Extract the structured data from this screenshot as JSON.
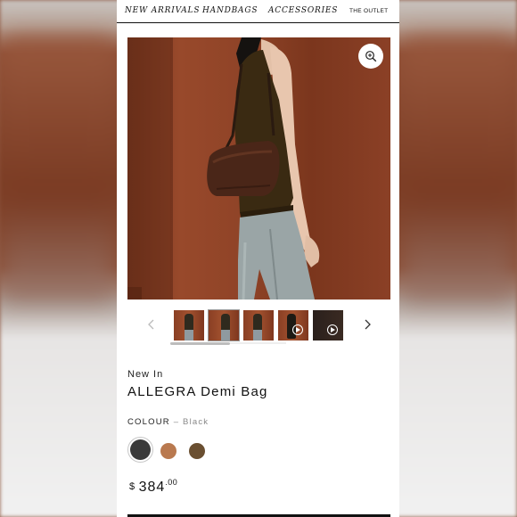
{
  "nav": {
    "items": [
      "NEW ARRIVALS",
      "HANDBAGS",
      "ACCESSORIES"
    ],
    "outlet": "THE OUTLET"
  },
  "gallery": {
    "zoom_icon": "zoom-in-icon",
    "prev_icon": "chevron-left-icon",
    "next_icon": "chevron-right-icon",
    "thumbnail_count": 5,
    "video_thumbnails": [
      4,
      5
    ]
  },
  "product": {
    "badge": "New In",
    "name": "ALLEGRA Demi Bag",
    "colour_label": "COLOUR",
    "colour_separator": "–",
    "colour_value": "Black",
    "swatches": [
      "#3a3a3a",
      "#b9794f",
      "#6a4f31"
    ],
    "price_currency": "$",
    "price_whole": "384",
    "price_cents": ".00"
  }
}
